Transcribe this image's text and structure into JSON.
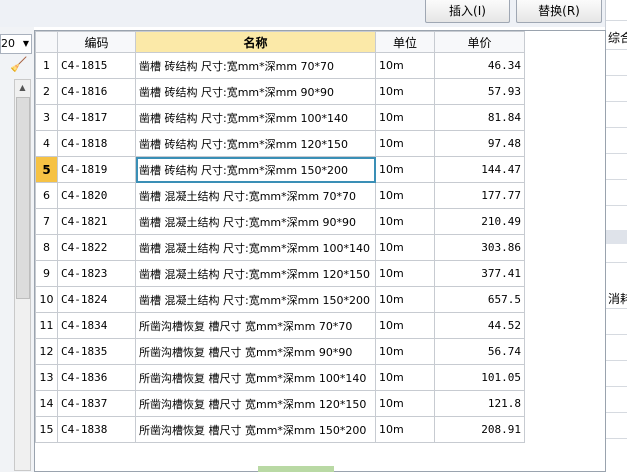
{
  "toolbar": {
    "combo_value": "20",
    "insert_label": "插入(I)",
    "replace_label": "替换(R)"
  },
  "right_panel": {
    "label_top": "综合",
    "label_mid": "消耗"
  },
  "table": {
    "headers": {
      "idx": "",
      "code": "编码",
      "name": "名称",
      "unit": "单位",
      "price": "单价"
    },
    "active_row": 5,
    "rows": [
      {
        "idx": "1",
        "code": "C4-1815",
        "name": "凿槽 砖结构 尺寸:宽mm*深mm 70*70",
        "unit": "10m",
        "price": "46.34"
      },
      {
        "idx": "2",
        "code": "C4-1816",
        "name": "凿槽 砖结构 尺寸:宽mm*深mm 90*90",
        "unit": "10m",
        "price": "57.93"
      },
      {
        "idx": "3",
        "code": "C4-1817",
        "name": "凿槽 砖结构 尺寸:宽mm*深mm 100*140",
        "unit": "10m",
        "price": "81.84"
      },
      {
        "idx": "4",
        "code": "C4-1818",
        "name": "凿槽 砖结构 尺寸:宽mm*深mm 120*150",
        "unit": "10m",
        "price": "97.48"
      },
      {
        "idx": "5",
        "code": "C4-1819",
        "name": "凿槽 砖结构 尺寸:宽mm*深mm 150*200",
        "unit": "10m",
        "price": "144.47"
      },
      {
        "idx": "6",
        "code": "C4-1820",
        "name": "凿槽 混凝土结构 尺寸:宽mm*深mm 70*70",
        "unit": "10m",
        "price": "177.77"
      },
      {
        "idx": "7",
        "code": "C4-1821",
        "name": "凿槽 混凝土结构 尺寸:宽mm*深mm 90*90",
        "unit": "10m",
        "price": "210.49"
      },
      {
        "idx": "8",
        "code": "C4-1822",
        "name": "凿槽 混凝土结构 尺寸:宽mm*深mm 100*140",
        "unit": "10m",
        "price": "303.86"
      },
      {
        "idx": "9",
        "code": "C4-1823",
        "name": "凿槽 混凝土结构 尺寸:宽mm*深mm 120*150",
        "unit": "10m",
        "price": "377.41"
      },
      {
        "idx": "10",
        "code": "C4-1824",
        "name": "凿槽 混凝土结构 尺寸:宽mm*深mm 150*200",
        "unit": "10m",
        "price": "657.5"
      },
      {
        "idx": "11",
        "code": "C4-1834",
        "name": "所凿沟槽恢复 槽尺寸 宽mm*深mm 70*70",
        "unit": "10m",
        "price": "44.52"
      },
      {
        "idx": "12",
        "code": "C4-1835",
        "name": "所凿沟槽恢复 槽尺寸 宽mm*深mm 90*90",
        "unit": "10m",
        "price": "56.74"
      },
      {
        "idx": "13",
        "code": "C4-1836",
        "name": "所凿沟槽恢复 槽尺寸 宽mm*深mm 100*140",
        "unit": "10m",
        "price": "101.05"
      },
      {
        "idx": "14",
        "code": "C4-1837",
        "name": "所凿沟槽恢复 槽尺寸 宽mm*深mm 120*150",
        "unit": "10m",
        "price": "121.8"
      },
      {
        "idx": "15",
        "code": "C4-1838",
        "name": "所凿沟槽恢复 槽尺寸 宽mm*深mm 150*200",
        "unit": "10m",
        "price": "208.91"
      }
    ]
  }
}
